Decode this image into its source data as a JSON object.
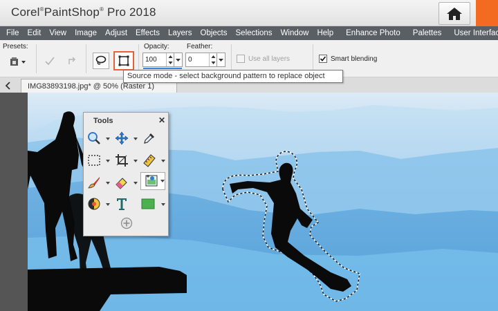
{
  "app": {
    "title_brand": "Corel",
    "title_product": "PaintShop",
    "title_suffix": "Pro 2018"
  },
  "menu": [
    "File",
    "Edit",
    "View",
    "Image",
    "Adjust",
    "Effects",
    "Layers",
    "Objects",
    "Selections",
    "Window",
    "Help",
    "Enhance Photo",
    "Palettes",
    "User Interface"
  ],
  "toolbar": {
    "presets_label": "Presets:",
    "opacity_label": "Opacity:",
    "opacity_value": "100",
    "feather_label": "Feather:",
    "feather_value": "0",
    "use_all_layers_label": "Use all layers",
    "use_all_layers_checked": false,
    "smart_blending_label": "Smart blending",
    "smart_blending_checked": true
  },
  "tooltip": "Source mode - select background pattern to replace object",
  "document_tab": {
    "label": "IMG83893198.jpg* @  50% (Raster 1)"
  },
  "tools_palette": {
    "title": "Tools",
    "close": "✕",
    "tools": [
      "zoom",
      "pan",
      "dropper",
      "selection",
      "crop",
      "straighten",
      "paint-brush",
      "eraser",
      "object-remover",
      "color-changer",
      "text",
      "rectangle-shape",
      "more-tools"
    ]
  },
  "icons": {
    "home": "home-icon"
  },
  "colors": {
    "menubar": "#5a5f66",
    "accent": "#f26b21",
    "highlight": "#e8603a",
    "sky_top": "#d9eaf6",
    "sky_mid": "#6fb3e2"
  }
}
